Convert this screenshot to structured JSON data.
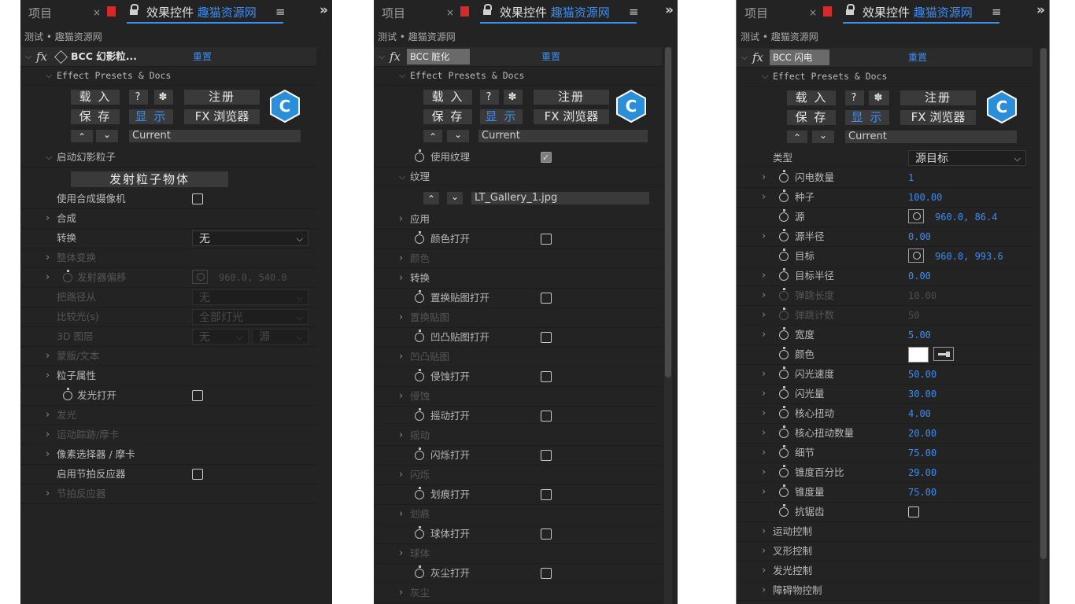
{
  "tabs": {
    "project": "项目",
    "close": "×",
    "title": "效果控件",
    "title_blue": "趣猫资源网",
    "menu": "≡",
    "more": "»"
  },
  "crumb": "测试 • 趣猫资源网",
  "common": {
    "presets": "Effect Presets & Docs",
    "load": "载 入",
    "help": "?",
    "gear": "✽",
    "register": "注册",
    "save": "保 存",
    "show": "显 示",
    "fx_browser": "FX 浏览器",
    "up": "⌃",
    "down": "⌄",
    "current": "Current",
    "reset": "重置",
    "fx": "fx"
  },
  "p1": {
    "effect": "BCC 幻影粒...",
    "start": "启动幻影粒子",
    "emit_btn": "发射粒子物体",
    "rows": [
      {
        "label": "使用合成摄像机",
        "kind": "cb"
      },
      {
        "label": "合成",
        "kind": "exp"
      },
      {
        "label": "转换",
        "kind": "dd",
        "value": "无"
      },
      {
        "label": "整体变换",
        "kind": "exp",
        "dis": true
      },
      {
        "label": "发射器偏移",
        "kind": "pos",
        "value": "960.0, 540.0",
        "dis": true
      },
      {
        "label": "把路径从",
        "kind": "dd",
        "value": "无",
        "dis": true
      },
      {
        "label": "比较光(s)",
        "kind": "dd",
        "value": "全部灯光",
        "dis": true
      },
      {
        "label": "3D 图层",
        "kind": "dd2",
        "value": "无",
        "value2": "源",
        "dis": true
      },
      {
        "label": "蒙版/文本",
        "kind": "exp",
        "dis": true
      },
      {
        "label": "粒子属性",
        "kind": "exp"
      },
      {
        "label": "发光打开",
        "kind": "swcb"
      },
      {
        "label": "发光",
        "kind": "exp",
        "dis": true
      },
      {
        "label": "运动踪跡/摩卡",
        "kind": "exp",
        "dis": true
      },
      {
        "label": "像素选择器 / 摩卡",
        "kind": "exp"
      },
      {
        "label": "启用节拍反应器",
        "kind": "cb"
      },
      {
        "label": "节拍反应器",
        "kind": "exp",
        "dis": true
      }
    ]
  },
  "p2": {
    "effect": "BCC 脏化",
    "use_texture": "使用纹理",
    "texture": "纹理",
    "texture_file": "LT_Gallery_1.jpg",
    "rows": [
      {
        "label": "应用",
        "kind": "exp"
      },
      {
        "label": "颜色打开",
        "kind": "swcb"
      },
      {
        "label": "颜色",
        "kind": "exp",
        "dis": true
      },
      {
        "label": "转换",
        "kind": "exp"
      },
      {
        "label": "置换贴图打开",
        "kind": "swcb"
      },
      {
        "label": "置换贴图",
        "kind": "exp",
        "dis": true
      },
      {
        "label": "凹凸贴图打开",
        "kind": "swcb"
      },
      {
        "label": "凹凸贴图",
        "kind": "exp",
        "dis": true
      },
      {
        "label": "侵蚀打开",
        "kind": "swcb"
      },
      {
        "label": "侵蚀",
        "kind": "exp",
        "dis": true
      },
      {
        "label": "摇动打开",
        "kind": "swcb"
      },
      {
        "label": "摇动",
        "kind": "exp",
        "dis": true
      },
      {
        "label": "闪烁打开",
        "kind": "swcb"
      },
      {
        "label": "闪烁",
        "kind": "exp",
        "dis": true
      },
      {
        "label": "划痕打开",
        "kind": "swcb"
      },
      {
        "label": "划痕",
        "kind": "exp",
        "dis": true
      },
      {
        "label": "球体打开",
        "kind": "swcb"
      },
      {
        "label": "球体",
        "kind": "exp",
        "dis": true
      },
      {
        "label": "灰尘打开",
        "kind": "swcb"
      },
      {
        "label": "灰尘",
        "kind": "exp",
        "dis": true
      }
    ]
  },
  "p3": {
    "effect": "BCC 闪电",
    "type_label": "类型",
    "type_value": "源目标",
    "rows": [
      {
        "label": "闪电数量",
        "kind": "num",
        "value": "1",
        "exp": true
      },
      {
        "label": "种子",
        "kind": "num",
        "value": "100.00",
        "exp": true
      },
      {
        "label": "源",
        "kind": "pos",
        "value": "960.0, 86.4"
      },
      {
        "label": "源半径",
        "kind": "num",
        "value": "0.00",
        "exp": true
      },
      {
        "label": "目标",
        "kind": "pos",
        "value": "960.0, 993.6"
      },
      {
        "label": "目标半径",
        "kind": "num",
        "value": "0.00",
        "exp": true
      },
      {
        "label": "弹跳长度",
        "kind": "num",
        "value": "10.00",
        "exp": true,
        "dis": true
      },
      {
        "label": "弹跳计数",
        "kind": "num",
        "value": "50",
        "exp": true,
        "dis": true
      },
      {
        "label": "宽度",
        "kind": "num",
        "value": "5.00",
        "exp": true
      },
      {
        "label": "颜色",
        "kind": "color"
      },
      {
        "label": "闪光速度",
        "kind": "num",
        "value": "50.00",
        "exp": true
      },
      {
        "label": "闪光量",
        "kind": "num",
        "value": "30.00",
        "exp": true
      },
      {
        "label": "核心扭动",
        "kind": "num",
        "value": "4.00",
        "exp": true
      },
      {
        "label": "核心扭动数量",
        "kind": "num",
        "value": "20.00",
        "exp": true
      },
      {
        "label": "细节",
        "kind": "num",
        "value": "75.00",
        "exp": true
      },
      {
        "label": "锥度百分比",
        "kind": "num",
        "value": "29.00",
        "exp": true
      },
      {
        "label": "锥度量",
        "kind": "num",
        "value": "75.00",
        "exp": true
      },
      {
        "label": "抗锯齿",
        "kind": "cb"
      },
      {
        "label": "运动控制",
        "kind": "grp"
      },
      {
        "label": "叉形控制",
        "kind": "grp"
      },
      {
        "label": "发光控制",
        "kind": "grp"
      },
      {
        "label": "障碍物控制",
        "kind": "grp"
      }
    ]
  }
}
